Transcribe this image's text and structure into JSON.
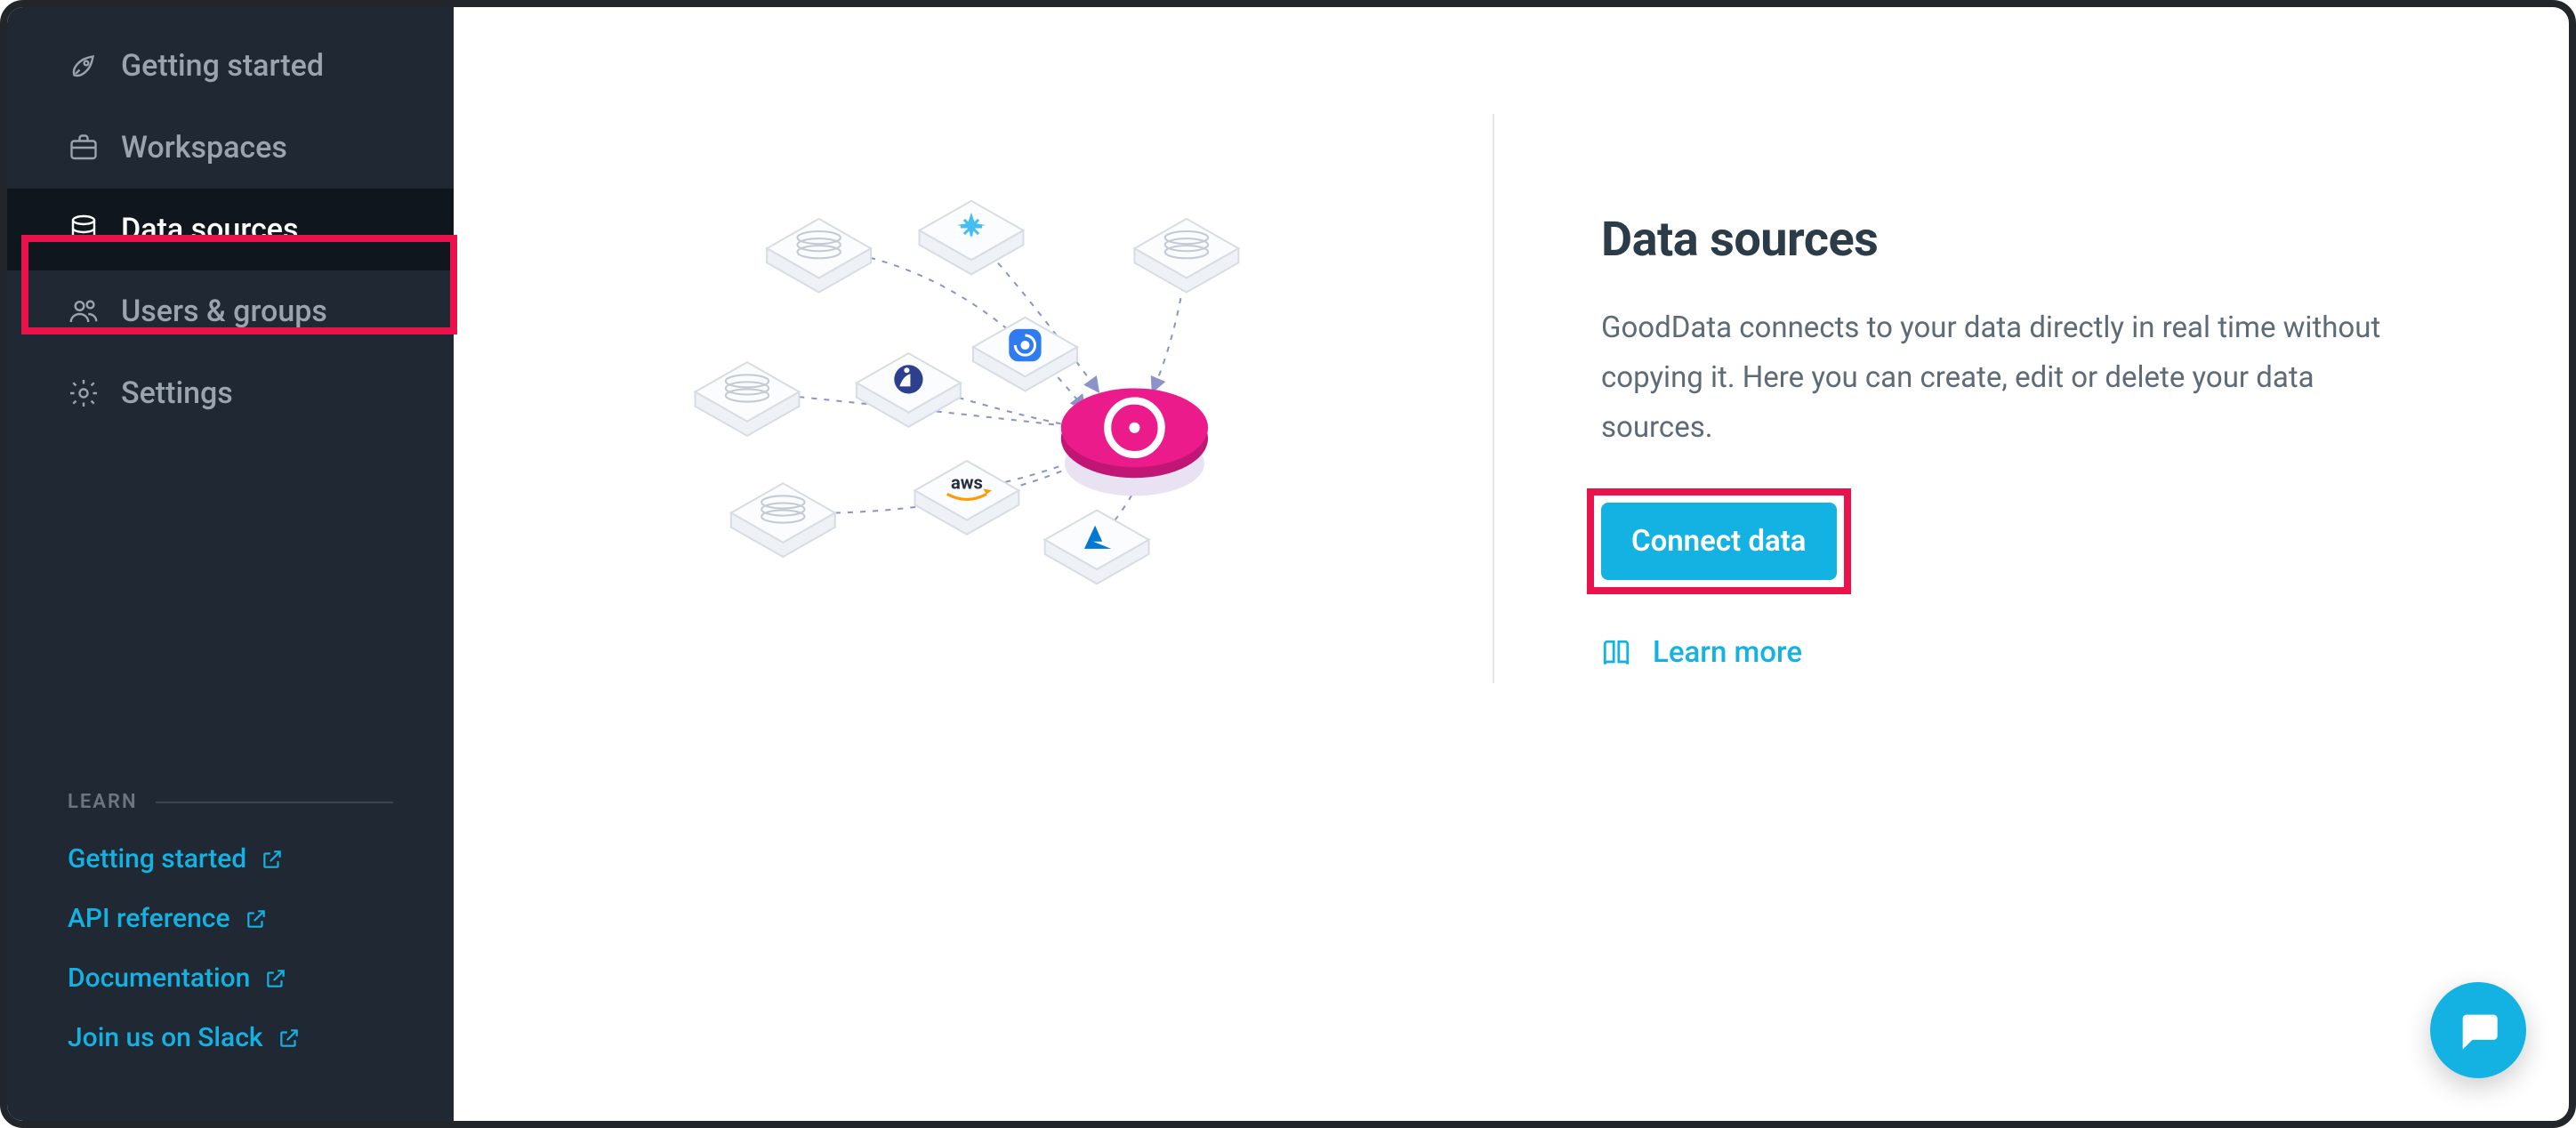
{
  "sidebar": {
    "items": [
      {
        "label": "Getting started",
        "icon": "rocket-icon",
        "active": false
      },
      {
        "label": "Workspaces",
        "icon": "briefcase-icon",
        "active": false
      },
      {
        "label": "Data sources",
        "icon": "database-icon",
        "active": true
      },
      {
        "label": "Users & groups",
        "icon": "users-icon",
        "active": false
      },
      {
        "label": "Settings",
        "icon": "gear-icon",
        "active": false
      }
    ]
  },
  "learn": {
    "header": "LEARN",
    "links": [
      {
        "label": "Getting started"
      },
      {
        "label": "API reference"
      },
      {
        "label": "Documentation"
      },
      {
        "label": "Join us on Slack"
      }
    ]
  },
  "main": {
    "title": "Data sources",
    "description": "GoodData connects to your data directly in real time without copying it. Here you can create, edit or delete your data sources.",
    "connect_button": "Connect data",
    "learn_more": "Learn more"
  },
  "colors": {
    "highlight": "#e9124b",
    "accent": "#ec1b8c",
    "link": "#14b2e2"
  }
}
